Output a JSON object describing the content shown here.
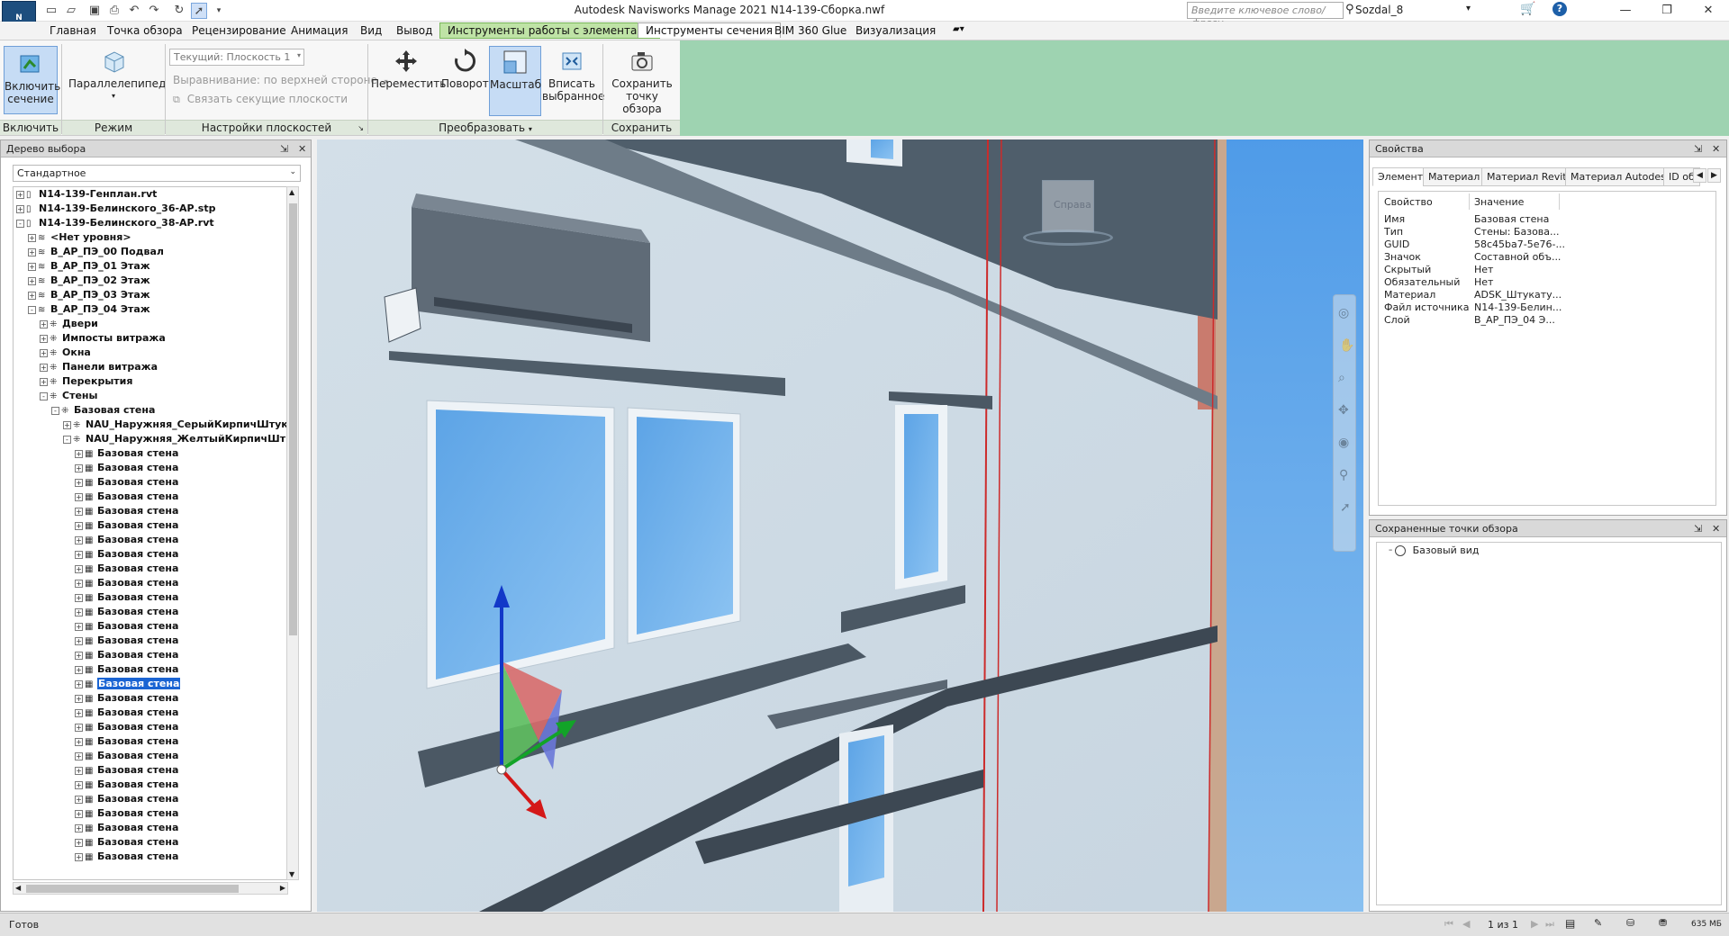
{
  "app": {
    "title": "Autodesk Navisworks Manage 2021    N14-139-Сборка.nwf",
    "logo": "N",
    "search_placeholder": "Введите ключевое слово/фразу",
    "user": "Sozdal_8"
  },
  "menu": {
    "items": [
      "Главная",
      "Точка обзора",
      "Рецензирование",
      "Анимация",
      "Вид",
      "Вывод"
    ],
    "context_tab": "Инструменты работы с элементами",
    "active_tab": "Инструменты сечения",
    "extra_items": [
      "BIM 360 Glue",
      "Визуализация"
    ]
  },
  "ribbon": {
    "enable": {
      "label": "Включить сечение",
      "group": "Включить"
    },
    "mode": {
      "label": "Параллелепипед",
      "group": "Режим"
    },
    "planes": {
      "current": "Текущий: Плоскость 1",
      "alignment": "Выравнивание: по верхней стороне",
      "link": "Связать секущие плоскости",
      "group": "Настройки плоскостей"
    },
    "transform": {
      "move": "Переместить",
      "rotate": "Поворот",
      "scale": "Масштаб",
      "fit": "Вписать выбранное",
      "group": "Преобразовать"
    },
    "save": {
      "label": "Сохранить точку обзора",
      "group": "Сохранить"
    }
  },
  "tree": {
    "title": "Дерево выбора",
    "mode": "Стандартное",
    "items": [
      {
        "level": 0,
        "exp": "+",
        "icon": "file",
        "label": "N14-139-Генплан.rvt"
      },
      {
        "level": 0,
        "exp": "+",
        "icon": "file",
        "label": "N14-139-Белинского_36-АР.stp"
      },
      {
        "level": 0,
        "exp": "-",
        "icon": "file",
        "label": "N14-139-Белинского_38-АР.rvt"
      },
      {
        "level": 1,
        "exp": "+",
        "icon": "layer",
        "label": "<Нет уровня>"
      },
      {
        "level": 1,
        "exp": "+",
        "icon": "layer",
        "label": "B_АР_ПЭ_00 Подвал"
      },
      {
        "level": 1,
        "exp": "+",
        "icon": "layer",
        "label": "B_АР_ПЭ_01 Этаж"
      },
      {
        "level": 1,
        "exp": "+",
        "icon": "layer",
        "label": "B_АР_ПЭ_02 Этаж"
      },
      {
        "level": 1,
        "exp": "+",
        "icon": "layer",
        "label": "B_АР_ПЭ_03 Этаж"
      },
      {
        "level": 1,
        "exp": "-",
        "icon": "layer",
        "label": "B_АР_ПЭ_04 Этаж"
      },
      {
        "level": 2,
        "exp": "+",
        "icon": "group",
        "label": "Двери"
      },
      {
        "level": 2,
        "exp": "+",
        "icon": "group",
        "label": "Импосты витража"
      },
      {
        "level": 2,
        "exp": "+",
        "icon": "group",
        "label": "Окна"
      },
      {
        "level": 2,
        "exp": "+",
        "icon": "group",
        "label": "Панели витража"
      },
      {
        "level": 2,
        "exp": "+",
        "icon": "group",
        "label": "Перекрытия"
      },
      {
        "level": 2,
        "exp": "-",
        "icon": "group",
        "label": "Стены"
      },
      {
        "level": 3,
        "exp": "-",
        "icon": "group",
        "label": "Базовая стена"
      },
      {
        "level": 4,
        "exp": "+",
        "icon": "group",
        "label": "NAU_Наружняя_СерыйКирпичШтук"
      },
      {
        "level": 4,
        "exp": "-",
        "icon": "group",
        "label": "NAU_Наружняя_ЖелтыйКирпичШт"
      },
      {
        "level": 5,
        "exp": "+",
        "icon": "obj",
        "label": "Базовая стена"
      },
      {
        "level": 5,
        "exp": "+",
        "icon": "obj",
        "label": "Базовая стена"
      },
      {
        "level": 5,
        "exp": "+",
        "icon": "obj",
        "label": "Базовая стена"
      },
      {
        "level": 5,
        "exp": "+",
        "icon": "obj",
        "label": "Базовая стена"
      },
      {
        "level": 5,
        "exp": "+",
        "icon": "obj",
        "label": "Базовая стена"
      },
      {
        "level": 5,
        "exp": "+",
        "icon": "obj",
        "label": "Базовая стена"
      },
      {
        "level": 5,
        "exp": "+",
        "icon": "obj",
        "label": "Базовая стена"
      },
      {
        "level": 5,
        "exp": "+",
        "icon": "obj",
        "label": "Базовая стена"
      },
      {
        "level": 5,
        "exp": "+",
        "icon": "obj",
        "label": "Базовая стена"
      },
      {
        "level": 5,
        "exp": "+",
        "icon": "obj",
        "label": "Базовая стена"
      },
      {
        "level": 5,
        "exp": "+",
        "icon": "obj",
        "label": "Базовая стена"
      },
      {
        "level": 5,
        "exp": "+",
        "icon": "obj",
        "label": "Базовая стена"
      },
      {
        "level": 5,
        "exp": "+",
        "icon": "obj",
        "label": "Базовая стена"
      },
      {
        "level": 5,
        "exp": "+",
        "icon": "obj",
        "label": "Базовая стена"
      },
      {
        "level": 5,
        "exp": "+",
        "icon": "obj",
        "label": "Базовая стена"
      },
      {
        "level": 5,
        "exp": "+",
        "icon": "obj",
        "label": "Базовая стена"
      },
      {
        "level": 5,
        "exp": "+",
        "icon": "obj",
        "label": "Базовая стена",
        "selected": true
      },
      {
        "level": 5,
        "exp": "+",
        "icon": "obj",
        "label": "Базовая стена"
      },
      {
        "level": 5,
        "exp": "+",
        "icon": "obj",
        "label": "Базовая стена"
      },
      {
        "level": 5,
        "exp": "+",
        "icon": "obj",
        "label": "Базовая стена"
      },
      {
        "level": 5,
        "exp": "+",
        "icon": "obj",
        "label": "Базовая стена"
      },
      {
        "level": 5,
        "exp": "+",
        "icon": "obj",
        "label": "Базовая стена"
      },
      {
        "level": 5,
        "exp": "+",
        "icon": "obj",
        "label": "Базовая стена"
      },
      {
        "level": 5,
        "exp": "+",
        "icon": "obj",
        "label": "Базовая стена"
      },
      {
        "level": 5,
        "exp": "+",
        "icon": "obj",
        "label": "Базовая стена"
      },
      {
        "level": 5,
        "exp": "+",
        "icon": "obj",
        "label": "Базовая стена"
      },
      {
        "level": 5,
        "exp": "+",
        "icon": "obj",
        "label": "Базовая стена"
      },
      {
        "level": 5,
        "exp": "+",
        "icon": "obj",
        "label": "Базовая стена"
      },
      {
        "level": 5,
        "exp": "+",
        "icon": "obj",
        "label": "Базовая стена"
      }
    ]
  },
  "viewcube": {
    "label": "Справа"
  },
  "properties": {
    "title": "Свойства",
    "tabs": [
      "Элемент",
      "Материал",
      "Материал Revit",
      "Материал Autodesk",
      "ID об"
    ],
    "col_property": "Свойство",
    "col_value": "Значение",
    "rows": [
      {
        "name": "Имя",
        "value": "Базовая стена"
      },
      {
        "name": "Тип",
        "value": "Стены: Базова..."
      },
      {
        "name": "GUID",
        "value": "58c45ba7-5e76-..."
      },
      {
        "name": "Значок",
        "value": "Составной объ..."
      },
      {
        "name": "Скрытый",
        "value": "Нет"
      },
      {
        "name": "Обязательный",
        "value": "Нет"
      },
      {
        "name": "Материал",
        "value": "ADSK_Штукату..."
      },
      {
        "name": "Файл источника",
        "value": "N14-139-Белин..."
      },
      {
        "name": "Слой",
        "value": "B_АР_ПЭ_04 Э..."
      }
    ]
  },
  "viewpoints": {
    "title": "Сохраненные точки обзора",
    "items": [
      "Базовый вид"
    ]
  },
  "status": {
    "text": "Готов",
    "page": "1 из 1",
    "memory": "635 МБ"
  }
}
